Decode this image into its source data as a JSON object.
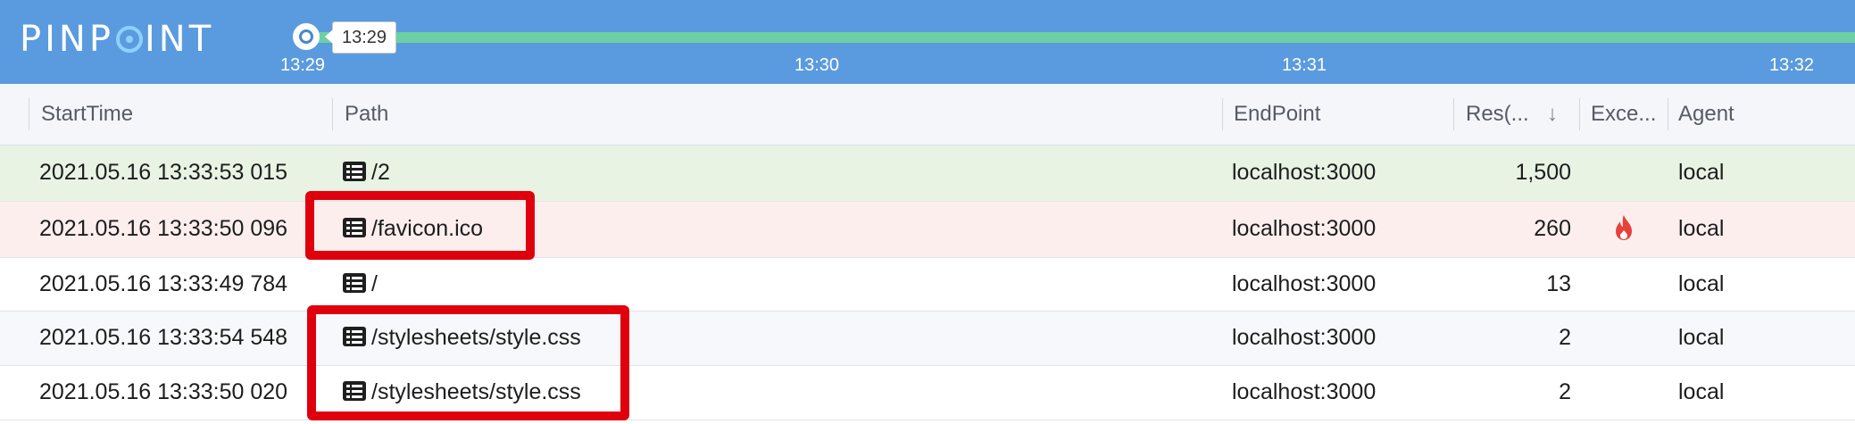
{
  "app": {
    "logo_left": "PINP",
    "logo_right": "INT"
  },
  "timeline": {
    "tooltip": "13:29",
    "ticks": [
      "13:29",
      "13:30",
      "13:31",
      "13:32"
    ]
  },
  "table": {
    "columns": {
      "start_time": "StartTime",
      "path": "Path",
      "endpoint": "EndPoint",
      "response": "Res(...",
      "sort_arrow": "↓",
      "exception": "Exce...",
      "agent": "Agent"
    },
    "rows": [
      {
        "start_time": "2021.05.16 13:33:53 015",
        "path": "/2",
        "endpoint": "localhost:3000",
        "response": "1,500",
        "exception": "",
        "agent": "local"
      },
      {
        "start_time": "2021.05.16 13:33:50 096",
        "path": "/favicon.ico",
        "endpoint": "localhost:3000",
        "response": "260",
        "exception": "fire-icon",
        "agent": "local"
      },
      {
        "start_time": "2021.05.16 13:33:49 784",
        "path": "/",
        "endpoint": "localhost:3000",
        "response": "13",
        "exception": "",
        "agent": "local"
      },
      {
        "start_time": "2021.05.16 13:33:54 548",
        "path": "/stylesheets/style.css",
        "endpoint": "localhost:3000",
        "response": "2",
        "exception": "",
        "agent": "local"
      },
      {
        "start_time": "2021.05.16 13:33:50 020",
        "path": "/stylesheets/style.css",
        "endpoint": "localhost:3000",
        "response": "2",
        "exception": "",
        "agent": "local"
      }
    ]
  },
  "colors": {
    "topbar": "#5a9be0",
    "timeline_track": "#6dcfa3",
    "row_success": "#e8f3e4",
    "row_error": "#fdeeee",
    "row_alt": "#f7f8fb",
    "highlight": "#e0000d",
    "flame": "#e8413a"
  }
}
